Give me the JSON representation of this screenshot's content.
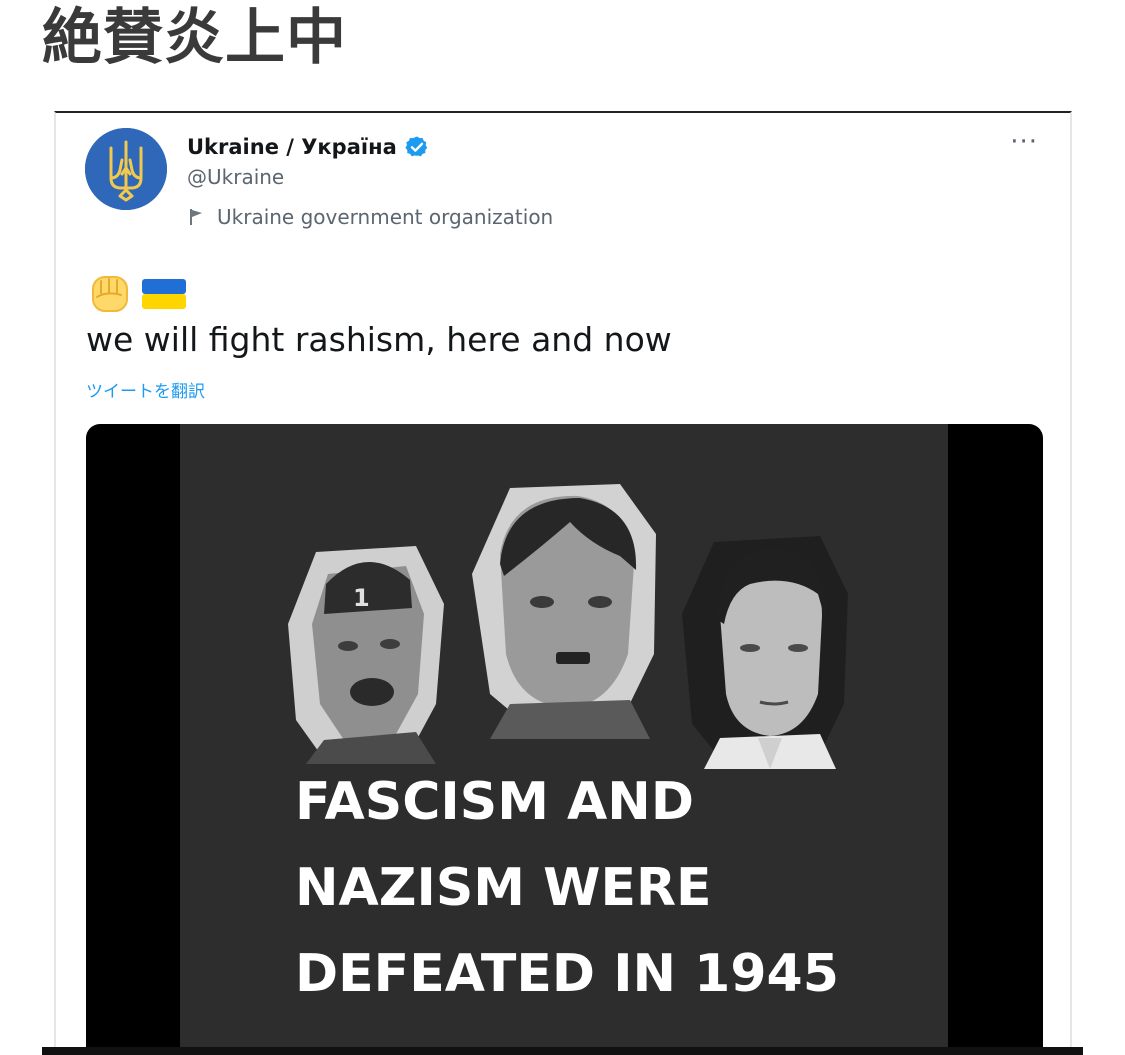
{
  "headline": "絶賛炎上中",
  "tweet": {
    "display_name": "Ukraine / Україна",
    "handle": "@Ukraine",
    "org_label": "Ukraine government organization",
    "text": "we will fight rashism, here and now",
    "translate_label": "ツイートを翻訳",
    "more_label": "···",
    "emojis": [
      "raised-fist",
      "ukraine-flag"
    ]
  },
  "media": {
    "overlay_lines": [
      "FASCISM AND",
      "NAZISM WERE",
      "DEFEATED IN 1945"
    ],
    "portrait_badge": "1"
  },
  "colors": {
    "accent": "#1d9bf0",
    "avatar_bg": "#2f67b9",
    "trident": "#f2c94c",
    "flag_blue": "#1f6fd6",
    "flag_yellow": "#ffd500",
    "media_bg": "#2d2d2d"
  }
}
